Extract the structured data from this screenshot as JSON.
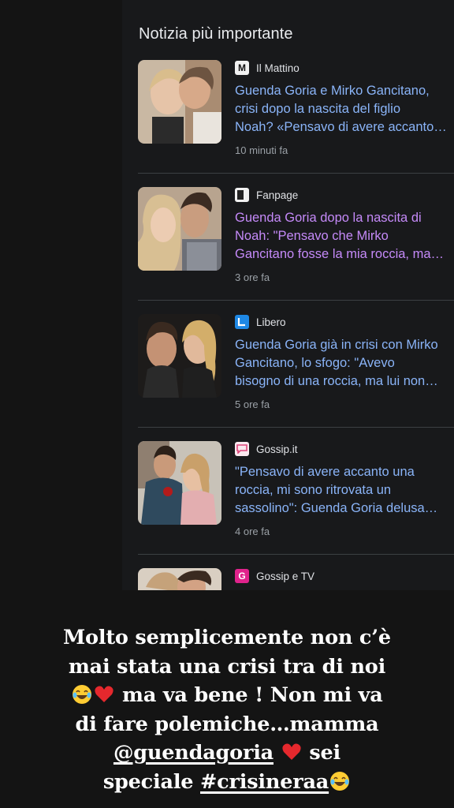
{
  "card": {
    "section_title": "Notizia più importante"
  },
  "news": [
    {
      "source": "Il Mattino",
      "logo_letter": "M",
      "logo_icon": "il-mattino-logo",
      "headline": "Guenda Goria e Mirko Gancitano,\ncrisi dopo la nascita del figlio\nNoah? «Pensavo di avere accanto…",
      "visited": false,
      "time": "10 minuti fa"
    },
    {
      "source": "Fanpage",
      "logo_letter": "",
      "logo_icon": "fanpage-logo",
      "headline": "Guenda Goria dopo la nascita di\nNoah: \"Pensavo che Mirko\nGancitano fosse la mia roccia, ma…",
      "visited": true,
      "time": "3 ore fa"
    },
    {
      "source": "Libero",
      "logo_letter": "",
      "logo_icon": "libero-logo",
      "headline": "Guenda Goria già in crisi con Mirko\nGancitano, lo sfogo: \"Avevo\nbisogno di una roccia, ma lui non…",
      "visited": false,
      "time": "5 ore fa"
    },
    {
      "source": "Gossip.it",
      "logo_letter": "",
      "logo_icon": "gossip-it-logo",
      "headline": "\"Pensavo di avere accanto una\nroccia, mi sono ritrovata un\nsassolino\": Guenda Goria delusa…",
      "visited": false,
      "time": "4 ore fa"
    },
    {
      "source": "Gossip e TV",
      "logo_letter": "G",
      "logo_icon": "gossip-e-tv-logo",
      "headline": "",
      "visited": false,
      "time": ""
    }
  ],
  "caption": {
    "line1": "Molto semplicemente non c’è",
    "line2": "mai stata una crisi tra di noi",
    "line3_text": " ma va bene ! Non mi va",
    "line4": "di fare polemiche…mamma",
    "mention": "@guendagoria",
    "line5_text": " sei",
    "line6_pre": "speciale ",
    "hashtag": "#crisineraa",
    "emojis": [
      "laughing-emoji",
      "red-heart-emoji"
    ]
  },
  "colors": {
    "background": "#141414",
    "card": "#18191b",
    "link": "#8ab4f8",
    "visited_link": "#c58af9",
    "meta": "#9aa0a6"
  }
}
